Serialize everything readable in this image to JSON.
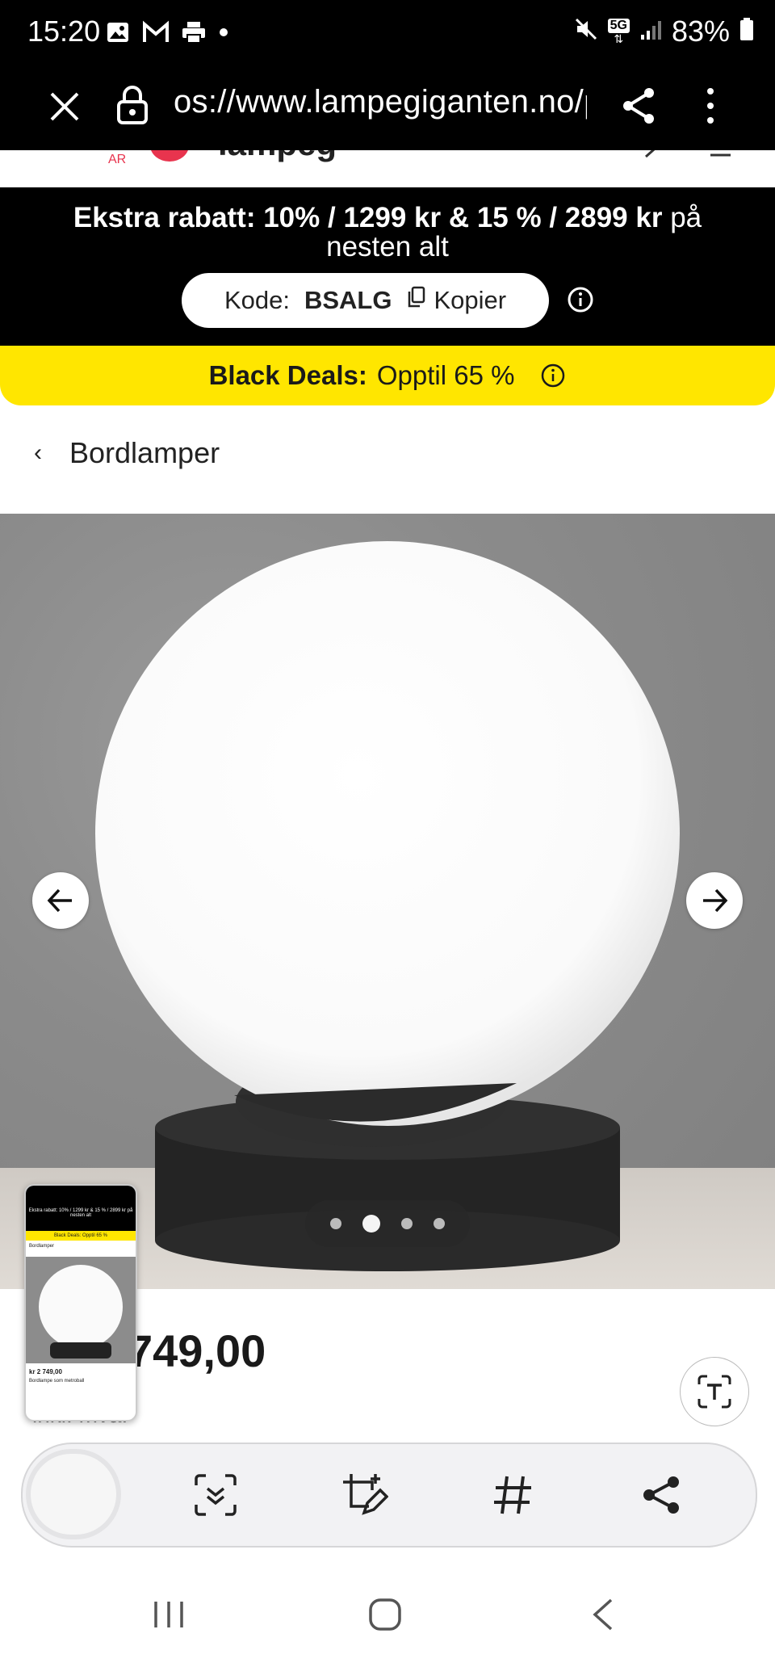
{
  "status_bar": {
    "time": "15:20",
    "battery": "83%",
    "network": "5G",
    "icons": [
      "gallery-icon",
      "gmail-icon",
      "print-icon",
      "dot-icon",
      "mute-icon",
      "5g-icon",
      "signal-icon",
      "battery-icon"
    ]
  },
  "browser": {
    "url": "os://www.lampegiganten.no/p",
    "icons": [
      "close-icon",
      "lock-icon",
      "share-icon",
      "more-vert-icon"
    ]
  },
  "promo": {
    "line1_bold": "Ekstra rabatt: 10% / 1299 kr & 15 % / 2899 kr",
    "line1_rest": " på",
    "line2": "nesten alt",
    "code_label": "Kode:",
    "code_value": "BSALG",
    "copy_label": "Kopier"
  },
  "black_deals": {
    "bold": "Black Deals:",
    "rest": "Opptil 65 %"
  },
  "breadcrumb": {
    "back_glyph": "‹",
    "label": "Bordlamper"
  },
  "gallery": {
    "slide_count": 4,
    "active_index": 1
  },
  "price": {
    "visible_text": "749,00",
    "vat_text": "inkl. mva."
  },
  "thumbnail": {
    "price_text": "kr 2 749,00",
    "title_text": "Bordlampe som metroball",
    "breadcrumb_text": "Bordlamper",
    "promo_text": "Ekstra rabatt: 10% / 1299 kr & 15 % / 2899 kr på nesten alt",
    "deals_text": "Black Deals: Opptil 65 %"
  },
  "colors": {
    "accent_yellow": "#ffe600",
    "promo_black": "#000000",
    "brand_red": "#e8344e"
  },
  "toolbar_icons": [
    "scan-icon",
    "crop-edit-icon",
    "hashtag-icon",
    "share-icon"
  ],
  "nav_icons": [
    "recents-icon",
    "home-icon",
    "back-icon"
  ]
}
